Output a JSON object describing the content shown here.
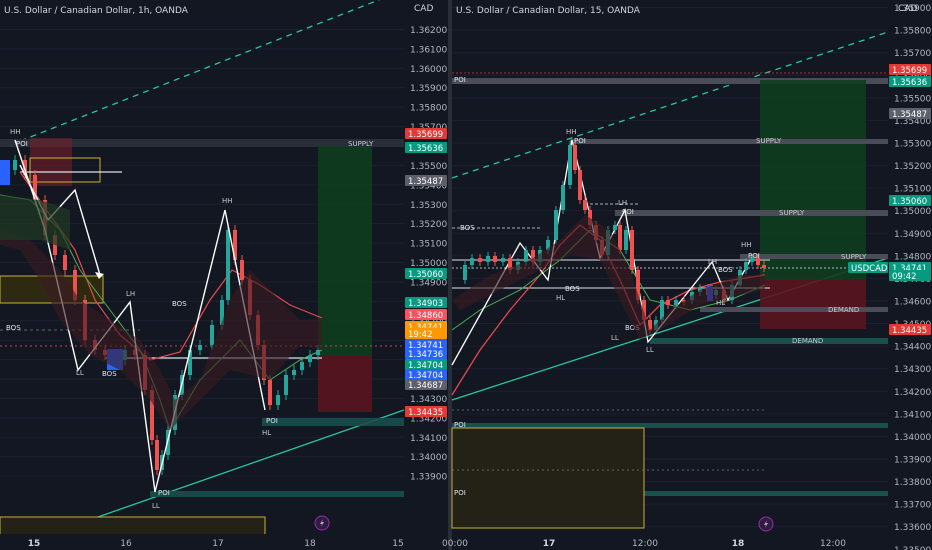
{
  "charts": [
    {
      "title": "U.S. Dollar / Canadian Dollar, 1h, OANDA",
      "currency": "CAD",
      "price_ticks": [
        "1.36200",
        "1.36100",
        "1.36000",
        "1.35900",
        "1.35800",
        "1.35700",
        "1.35600",
        "1.35500",
        "1.35400",
        "1.35300",
        "1.35200",
        "1.35100",
        "1.35000",
        "1.34900",
        "1.34800",
        "1.34700",
        "1.34600",
        "1.34500",
        "1.34400",
        "1.34300",
        "1.34200",
        "1.34100",
        "1.34000",
        "1.33900"
      ],
      "time_ticks": [
        "15",
        "16",
        "17",
        "18",
        "15"
      ],
      "price_badges": [
        {
          "text": "1.35699",
          "color": "#e53935"
        },
        {
          "text": "1.35636",
          "color": "#089981"
        },
        {
          "text": "1.35487",
          "color": "#5d606b"
        },
        {
          "text": "1.35060",
          "color": "#089981"
        },
        {
          "text": "1.34903",
          "color": "#089981"
        },
        {
          "text": "1.34860",
          "color": "#f7525f"
        },
        {
          "text": "1.34741",
          "color": "#ff9800"
        },
        {
          "text": "19:42",
          "color": "#ff9800"
        },
        {
          "text": "1.34741",
          "color": "#2962ff"
        },
        {
          "text": "1.34736",
          "color": "#2962ff"
        },
        {
          "text": "1.34704",
          "color": "#089981"
        },
        {
          "text": "1.34704",
          "color": "#2962ff"
        },
        {
          "text": "1.34687",
          "color": "#5d606b"
        },
        {
          "text": "1.34435",
          "color": "#e53935"
        }
      ],
      "annotations": [
        "POI",
        "SUPPLY",
        "BOS",
        "BOS",
        "BOS",
        "HH",
        "HH",
        "LH",
        "LL",
        "HL",
        "LL",
        "POI",
        "POI"
      ]
    },
    {
      "title": "U.S. Dollar / Canadian Dollar, 15, OANDA",
      "currency": "CAD",
      "price_ticks": [
        "1.35900",
        "1.35800",
        "1.35700",
        "1.35600",
        "1.35500",
        "1.35400",
        "1.35300",
        "1.35200",
        "1.35100",
        "1.35000",
        "1.34900",
        "1.34800",
        "1.34700",
        "1.34600",
        "1.34500",
        "1.34400",
        "1.34300",
        "1.34200",
        "1.34100",
        "1.34000",
        "1.33900",
        "1.33800",
        "1.33700",
        "1.33600",
        "1.33500"
      ],
      "time_ticks": [
        "00:00",
        "17",
        "12:00",
        "18",
        "12:00"
      ],
      "price_badges": [
        {
          "text": "1.35699",
          "color": "#e53935"
        },
        {
          "text": "1.35636",
          "color": "#089981"
        },
        {
          "text": "1.35487",
          "color": "#5d606b"
        },
        {
          "text": "1.35060",
          "color": "#089981"
        },
        {
          "text": "1.34741",
          "color": "#089981"
        },
        {
          "text": "09:42",
          "color": "#089981"
        },
        {
          "text": "1.34435",
          "color": "#e53935"
        }
      ],
      "symbol_badge": "USDCAD",
      "annotations": [
        "POI",
        "SUPPLY",
        "SUPPLY",
        "SUPPLY",
        "DEMAND",
        "DEMAND",
        "POI",
        "POI",
        "POI",
        "POI",
        "POI",
        "BOS",
        "BOS",
        "BOS",
        "BOS",
        "HH",
        "HH",
        "LH",
        "LH",
        "HL",
        "HL",
        "LL",
        "LL"
      ]
    }
  ]
}
